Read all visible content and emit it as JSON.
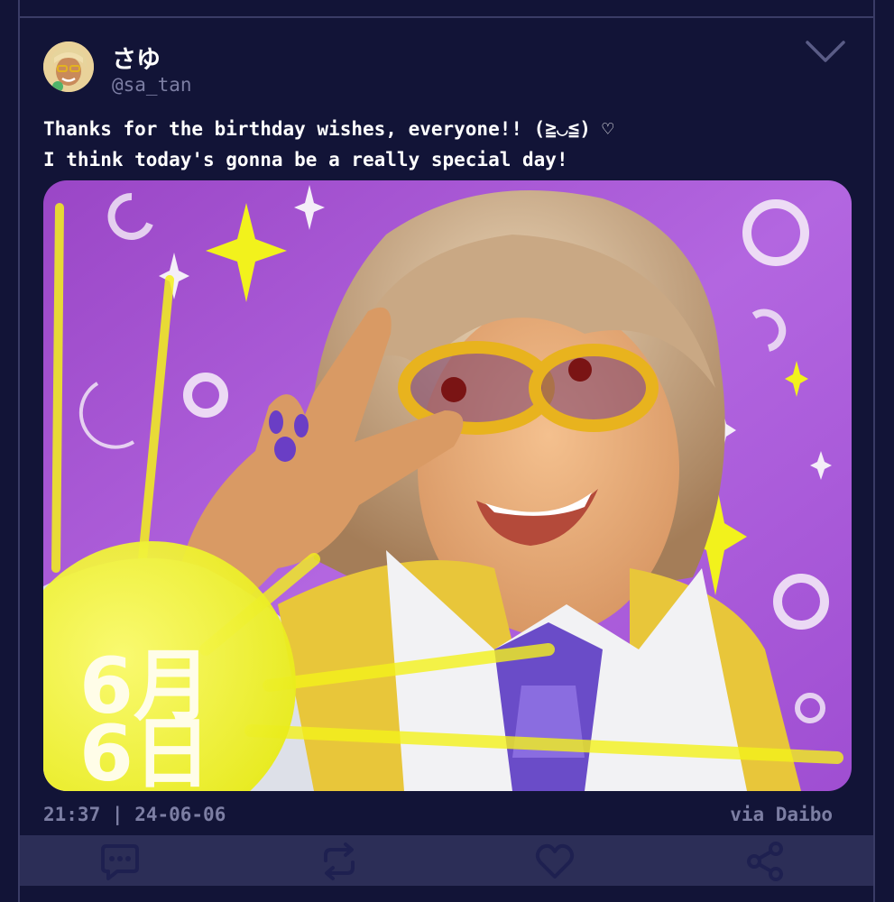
{
  "post": {
    "display_name": "さゆ",
    "handle": "@sa_tan",
    "text": "Thanks for the birthday wishes, everyone!! (≧◡≦) ♡\nI think today's gonna be a really special day!",
    "time": "21:37",
    "separator": "|",
    "date": "24-06-06",
    "via": "via Daibo",
    "image_caption": "6月\n6日"
  },
  "actions": [
    {
      "name": "reply-icon",
      "icon": "speech-bubble"
    },
    {
      "name": "repost-icon",
      "icon": "repeat-arrows"
    },
    {
      "name": "like-icon",
      "icon": "heart"
    },
    {
      "name": "share-icon",
      "icon": "share-nodes"
    }
  ],
  "colors": {
    "background": "#121437",
    "action_bar": "#2c2e57",
    "icon": "#1e2050",
    "muted_text": "#7c7ea3",
    "accent_purple": "#a44fd1",
    "accent_yellow": "#f4f21c"
  }
}
